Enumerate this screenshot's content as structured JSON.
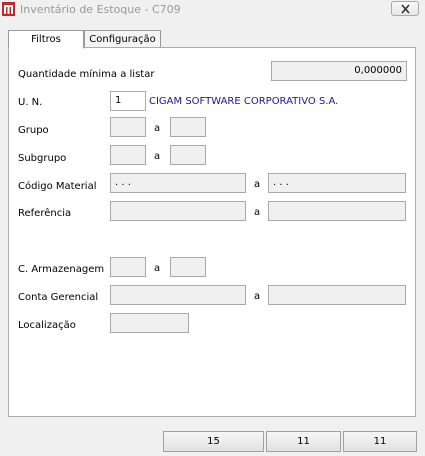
{
  "window": {
    "title": "Inventário de Estoque - C709"
  },
  "tabs": [
    {
      "label": "Filtros",
      "active": true
    },
    {
      "label": "Configuração",
      "active": false
    }
  ],
  "filters": {
    "quantidade_minima": {
      "label": "Quantidade mínima a listar",
      "value": "0,000000"
    },
    "un": {
      "label": "U. N.",
      "value": "1",
      "description": "CIGAM SOFTWARE CORPORATIVO S.A."
    },
    "grupo": {
      "label": "Grupo",
      "from": "",
      "to": ""
    },
    "subgrupo": {
      "label": "Subgrupo",
      "from": "",
      "to": ""
    },
    "codigo_material": {
      "label": "Código Material",
      "from": ". . .",
      "to": ". . ."
    },
    "referencia": {
      "label": "Referência",
      "from": "",
      "to": ""
    },
    "c_armazenagem": {
      "label": "C. Armazenagem",
      "from": "",
      "to": ""
    },
    "conta_gerencial": {
      "label": "Conta Gerencial",
      "from": "",
      "to": ""
    },
    "localizacao": {
      "label": "Localização",
      "value": ""
    },
    "range_sep": "a"
  },
  "footer": {
    "buttons": [
      "15",
      "11",
      "11"
    ]
  },
  "colors": {
    "title_text": "#9a9a9a",
    "icon_red": "#c0282d",
    "un_description": "#1a1a8a"
  }
}
